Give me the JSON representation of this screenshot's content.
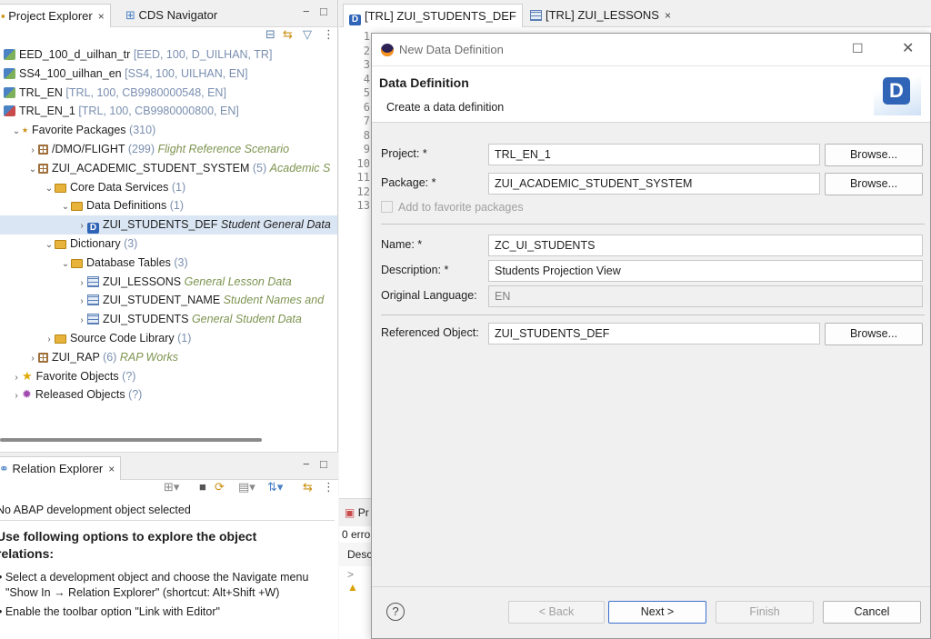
{
  "project_explorer": {
    "tabs": [
      {
        "label": "Project Explorer"
      },
      {
        "label": "CDS Navigator"
      }
    ],
    "tree": [
      {
        "depth": 0,
        "twisty": "",
        "icon": "proj",
        "label": "EED_100_d_uilhan_tr",
        "decoration": "[EED, 100, D_UILHAN, TR]",
        "description": ""
      },
      {
        "depth": 0,
        "twisty": "",
        "icon": "proj",
        "label": "SS4_100_uilhan_en",
        "decoration": "[SS4, 100, UILHAN, EN]",
        "description": ""
      },
      {
        "depth": 0,
        "twisty": "",
        "icon": "proj",
        "label": "TRL_EN",
        "decoration": "[TRL, 100, CB9980000548, EN]",
        "description": ""
      },
      {
        "depth": 0,
        "twisty": "",
        "icon": "proj2",
        "label": "TRL_EN_1",
        "decoration": "[TRL, 100, CB9980000800, EN]",
        "description": ""
      },
      {
        "depth": 1,
        "twisty": "v",
        "icon": "star-pkg",
        "label": "Favorite Packages",
        "decoration": "(310)",
        "description": ""
      },
      {
        "depth": 2,
        "twisty": ">",
        "icon": "pkg",
        "label": "/DMO/FLIGHT",
        "decoration": "(299)",
        "description": "Flight Reference Scenario"
      },
      {
        "depth": 2,
        "twisty": "v",
        "icon": "pkg",
        "label": "ZUI_ACADEMIC_STUDENT_SYSTEM",
        "decoration": "(5)",
        "description": "Academic S"
      },
      {
        "depth": 3,
        "twisty": "v",
        "icon": "folder",
        "label": "Core Data Services",
        "decoration": "(1)",
        "description": ""
      },
      {
        "depth": 4,
        "twisty": "v",
        "icon": "folder",
        "label": "Data Definitions",
        "decoration": "(1)",
        "description": ""
      },
      {
        "depth": 5,
        "twisty": ">",
        "icon": "ddef",
        "label": "ZUI_STUDENTS_DEF",
        "decoration": "",
        "description": "Student General Data",
        "selected": true
      },
      {
        "depth": 3,
        "twisty": "v",
        "icon": "folder",
        "label": "Dictionary",
        "decoration": "(3)",
        "description": ""
      },
      {
        "depth": 4,
        "twisty": "v",
        "icon": "folder",
        "label": "Database Tables",
        "decoration": "(3)",
        "description": ""
      },
      {
        "depth": 5,
        "twisty": ">",
        "icon": "table",
        "label": "ZUI_LESSONS",
        "decoration": "",
        "description": "General Lesson Data"
      },
      {
        "depth": 5,
        "twisty": ">",
        "icon": "table",
        "label": "ZUI_STUDENT_NAME",
        "decoration": "",
        "description": "Student Names and"
      },
      {
        "depth": 5,
        "twisty": ">",
        "icon": "table",
        "label": "ZUI_STUDENTS",
        "decoration": "",
        "description": "General Student Data"
      },
      {
        "depth": 3,
        "twisty": ">",
        "icon": "folder",
        "label": "Source Code Library",
        "decoration": "(1)",
        "description": ""
      },
      {
        "depth": 2,
        "twisty": ">",
        "icon": "pkg",
        "label": "ZUI_RAP",
        "decoration": "(6)",
        "description": "RAP Works"
      },
      {
        "depth": 1,
        "twisty": ">",
        "icon": "yellowstar",
        "label": "Favorite Objects",
        "decoration": "(?)",
        "description": ""
      },
      {
        "depth": 1,
        "twisty": ">",
        "icon": "gear",
        "label": "Released Objects",
        "decoration": "(?)",
        "description": ""
      }
    ]
  },
  "relation_explorer": {
    "tab_label": "Relation Explorer",
    "message": "No ABAP development object selected",
    "heading": "Use following options to explore the object relations:",
    "bullets": [
      "• Select a development object and choose the Navigate menu \"Show In → Relation Explorer\" (shortcut: Alt+Shift +W)",
      "• Enable the toolbar option \"Link with Editor\""
    ]
  },
  "editor": {
    "tabs": [
      {
        "label": "[TRL] ZUI_STUDENTS_DEF"
      },
      {
        "label": "[TRL] ZUI_LESSONS"
      }
    ],
    "line_numbers": [
      "1",
      "2",
      "3",
      "4",
      "5",
      "6",
      "7",
      "8",
      "9",
      "10",
      "11",
      "12",
      "13"
    ],
    "problems_tab": "Pr",
    "problems_count": "0 erro",
    "problems_col": "Desc"
  },
  "dialog": {
    "window_title": "New Data Definition",
    "header_title": "Data Definition",
    "header_subtitle": "Create a data definition",
    "project_label": "Project: *",
    "project_value": "TRL_EN_1",
    "package_label": "Package: *",
    "package_value": "ZUI_ACADEMIC_STUDENT_SYSTEM",
    "browse_label": "Browse...",
    "favorite_label": "Add to favorite packages",
    "name_label": "Name: *",
    "name_value": "ZC_UI_STUDENTS",
    "description_label": "Description: *",
    "description_value": "Students  Projection View",
    "language_label": "Original Language:",
    "language_value": "EN",
    "referenced_label": "Referenced Object:",
    "referenced_value": "ZUI_STUDENTS_DEF",
    "help_label": "?",
    "back_label": "< Back",
    "next_label": "Next >",
    "finish_label": "Finish",
    "cancel_label": "Cancel"
  }
}
